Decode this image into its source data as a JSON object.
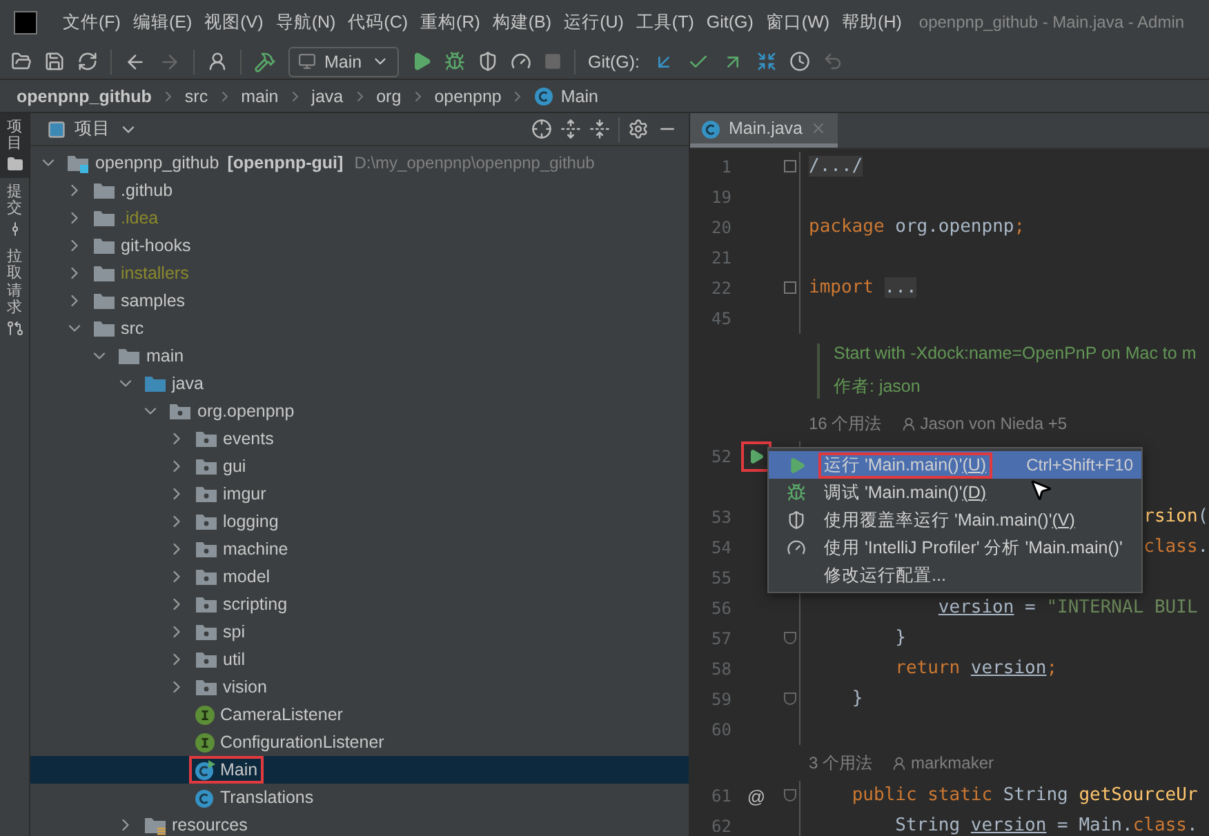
{
  "menubar": {
    "items": [
      "文件(F)",
      "编辑(E)",
      "视图(V)",
      "导航(N)",
      "代码(C)",
      "重构(R)",
      "构建(B)",
      "运行(U)",
      "工具(T)",
      "Git(G)",
      "窗口(W)",
      "帮助(H)"
    ],
    "title": "openpnp_github - Main.java - Admin"
  },
  "toolbar": {
    "run_config": "Main",
    "git_label": "Git(G):"
  },
  "breadcrumb": [
    {
      "label": "openpnp_github",
      "kind": "project"
    },
    {
      "label": "src",
      "kind": "dir"
    },
    {
      "label": "main",
      "kind": "dir"
    },
    {
      "label": "java",
      "kind": "dir"
    },
    {
      "label": "org",
      "kind": "dir"
    },
    {
      "label": "openpnp",
      "kind": "dir"
    },
    {
      "label": "Main",
      "kind": "class"
    }
  ],
  "side_tabs": [
    {
      "label": "项目",
      "selected": true,
      "kind": "project"
    },
    {
      "label": "提交",
      "selected": false,
      "kind": "commit"
    },
    {
      "label": "拉取请求",
      "selected": false,
      "kind": "pull"
    }
  ],
  "project_panel": {
    "title": "项目",
    "tree": [
      {
        "name": "openpnp_github",
        "module": "[openpnp-gui]",
        "path": "D:\\my_openpnp\\openpnp_github",
        "kind": "project",
        "expanded": true,
        "selected": false,
        "ignored": false,
        "highlighted": false,
        "children": [
          {
            "name": ".github",
            "kind": "folder",
            "expanded": false,
            "selected": false,
            "ignored": false,
            "highlighted": false
          },
          {
            "name": ".idea",
            "kind": "folder",
            "expanded": false,
            "selected": false,
            "ignored": true,
            "highlighted": false
          },
          {
            "name": "git-hooks",
            "kind": "folder",
            "expanded": false,
            "selected": false,
            "ignored": false,
            "highlighted": false
          },
          {
            "name": "installers",
            "kind": "folder",
            "expanded": false,
            "selected": false,
            "ignored": true,
            "highlighted": false
          },
          {
            "name": "samples",
            "kind": "folder",
            "expanded": false,
            "selected": false,
            "ignored": false,
            "highlighted": false
          },
          {
            "name": "src",
            "kind": "folder",
            "expanded": true,
            "selected": false,
            "ignored": false,
            "highlighted": false,
            "children": [
              {
                "name": "main",
                "kind": "folder",
                "expanded": true,
                "selected": false,
                "ignored": false,
                "highlighted": false,
                "children": [
                  {
                    "name": "java",
                    "kind": "source",
                    "expanded": true,
                    "selected": false,
                    "ignored": false,
                    "highlighted": false,
                    "children": [
                      {
                        "name": "org.openpnp",
                        "kind": "package",
                        "expanded": true,
                        "selected": false,
                        "ignored": false,
                        "highlighted": false,
                        "children": [
                          {
                            "name": "events",
                            "kind": "package",
                            "expanded": false,
                            "selected": false,
                            "ignored": false,
                            "highlighted": false
                          },
                          {
                            "name": "gui",
                            "kind": "package",
                            "expanded": false,
                            "selected": false,
                            "ignored": false,
                            "highlighted": false
                          },
                          {
                            "name": "imgur",
                            "kind": "package",
                            "expanded": false,
                            "selected": false,
                            "ignored": false,
                            "highlighted": false
                          },
                          {
                            "name": "logging",
                            "kind": "package",
                            "expanded": false,
                            "selected": false,
                            "ignored": false,
                            "highlighted": false
                          },
                          {
                            "name": "machine",
                            "kind": "package",
                            "expanded": false,
                            "selected": false,
                            "ignored": false,
                            "highlighted": false
                          },
                          {
                            "name": "model",
                            "kind": "package",
                            "expanded": false,
                            "selected": false,
                            "ignored": false,
                            "highlighted": false
                          },
                          {
                            "name": "scripting",
                            "kind": "package",
                            "expanded": false,
                            "selected": false,
                            "ignored": false,
                            "highlighted": false
                          },
                          {
                            "name": "spi",
                            "kind": "package",
                            "expanded": false,
                            "selected": false,
                            "ignored": false,
                            "highlighted": false
                          },
                          {
                            "name": "util",
                            "kind": "package",
                            "expanded": false,
                            "selected": false,
                            "ignored": false,
                            "highlighted": false
                          },
                          {
                            "name": "vision",
                            "kind": "package",
                            "expanded": false,
                            "selected": false,
                            "ignored": false,
                            "highlighted": false
                          },
                          {
                            "name": "CameraListener",
                            "kind": "interface",
                            "selected": false,
                            "ignored": false,
                            "highlighted": false
                          },
                          {
                            "name": "ConfigurationListener",
                            "kind": "interface",
                            "selected": false,
                            "ignored": false,
                            "highlighted": false
                          },
                          {
                            "name": "Main",
                            "kind": "main_class",
                            "selected": true,
                            "ignored": false,
                            "highlighted": true
                          },
                          {
                            "name": "Translations",
                            "kind": "class",
                            "selected": false,
                            "ignored": false,
                            "highlighted": false
                          }
                        ]
                      }
                    ]
                  },
                  {
                    "name": "resources",
                    "kind": "resources",
                    "expanded": false,
                    "selected": false,
                    "ignored": false,
                    "highlighted": false
                  }
                ]
              }
            ]
          }
        ]
      }
    ]
  },
  "editor": {
    "tabs": [
      {
        "label": "Main.java",
        "selected": true
      }
    ],
    "rows": [
      {
        "kind": "code",
        "number": "1",
        "fold": {
          "kind": "collapsed"
        },
        "tokens": [
          {
            "t": "/.../",
            "kind": "folded"
          }
        ]
      },
      {
        "kind": "code",
        "number": "19",
        "tokens": []
      },
      {
        "kind": "code",
        "number": "20",
        "tokens": [
          {
            "t": "package",
            "kind": "keyword"
          },
          {
            "t": " org.openpnp",
            "kind": "plain"
          },
          {
            "t": ";",
            "kind": "keyword"
          }
        ]
      },
      {
        "kind": "code",
        "number": "21",
        "tokens": []
      },
      {
        "kind": "code",
        "number": "22",
        "fold": {
          "kind": "collapsed"
        },
        "tokens": [
          {
            "t": "import ",
            "kind": "keyword"
          },
          {
            "t": "...",
            "kind": "folded"
          }
        ]
      },
      {
        "kind": "code",
        "number": "45",
        "tokens": []
      },
      {
        "kind": "doc",
        "lines": [
          "Start with -Xdock:name=OpenPnP on Mac to m",
          "作者: jason"
        ]
      },
      {
        "kind": "usages",
        "count": "16 个用法",
        "author": "Jason von Nieda +5"
      },
      {
        "kind": "code",
        "number": "52",
        "gutter": {
          "kind": "run",
          "highlighted": true
        },
        "tokens": []
      },
      {
        "kind": "code",
        "number": "53",
        "tokens": [
          {
            "t": "                               rsion",
            "kind": "method"
          },
          {
            "t": "(",
            "kind": "plain"
          }
        ]
      },
      {
        "kind": "code",
        "number": "54",
        "tokens": [
          {
            "t": "                               class",
            "kind": "keyword"
          },
          {
            "t": ".",
            "kind": "plain"
          }
        ]
      },
      {
        "kind": "code",
        "number": "55",
        "tokens": []
      },
      {
        "kind": "code",
        "number": "56",
        "tokens": [
          {
            "t": "            version",
            "kind": "field"
          },
          {
            "t": " = ",
            "kind": "plain"
          },
          {
            "t": "\"INTERNAL BUIL",
            "kind": "string"
          }
        ]
      },
      {
        "kind": "code",
        "number": "57",
        "fold": {
          "kind": "end"
        },
        "tokens": [
          {
            "t": "        }",
            "kind": "plain"
          }
        ]
      },
      {
        "kind": "code",
        "number": "58",
        "tokens": [
          {
            "t": "        return ",
            "kind": "keyword"
          },
          {
            "t": "version",
            "kind": "field"
          },
          {
            "t": ";",
            "kind": "keyword"
          }
        ]
      },
      {
        "kind": "code",
        "number": "59",
        "fold": {
          "kind": "end"
        },
        "tokens": [
          {
            "t": "    }",
            "kind": "plain"
          }
        ]
      },
      {
        "kind": "code",
        "number": "60",
        "tokens": []
      },
      {
        "kind": "usages",
        "count": "3 个用法",
        "author": "markmaker"
      },
      {
        "kind": "code",
        "number": "61",
        "gutter": {
          "kind": "annotation",
          "mark": "@"
        },
        "fold": {
          "kind": "start"
        },
        "tokens": [
          {
            "t": "    public static",
            "kind": "keyword"
          },
          {
            "t": " String ",
            "kind": "plain"
          },
          {
            "t": "getSourceUr",
            "kind": "method"
          }
        ]
      },
      {
        "kind": "code",
        "number": "62",
        "tokens": [
          {
            "t": "        String ",
            "kind": "plain"
          },
          {
            "t": "version",
            "kind": "field"
          },
          {
            "t": " = Main.",
            "kind": "plain"
          },
          {
            "t": "class",
            "kind": "keyword"
          },
          {
            "t": ".",
            "kind": "plain"
          }
        ]
      }
    ]
  },
  "popup": {
    "items": [
      {
        "kind": "run",
        "label": "运行 'Main.main()'",
        "mnemonic": "(U)",
        "shortcut": "Ctrl+Shift+F10",
        "selected": true,
        "highlighted": true
      },
      {
        "kind": "debug",
        "label": "调试 'Main.main()'",
        "mnemonic": "(D)",
        "selected": false,
        "highlighted": false
      },
      {
        "kind": "coverage",
        "label": "使用覆盖率运行  'Main.main()'",
        "mnemonic": "(V)",
        "selected": false,
        "highlighted": false
      },
      {
        "kind": "profiler",
        "label": "使用 'IntelliJ Profiler' 分析  'Main.main()'",
        "selected": false,
        "highlighted": false
      },
      {
        "kind": "edit",
        "label": "修改运行配置...",
        "selected": false,
        "highlighted": false
      }
    ]
  }
}
